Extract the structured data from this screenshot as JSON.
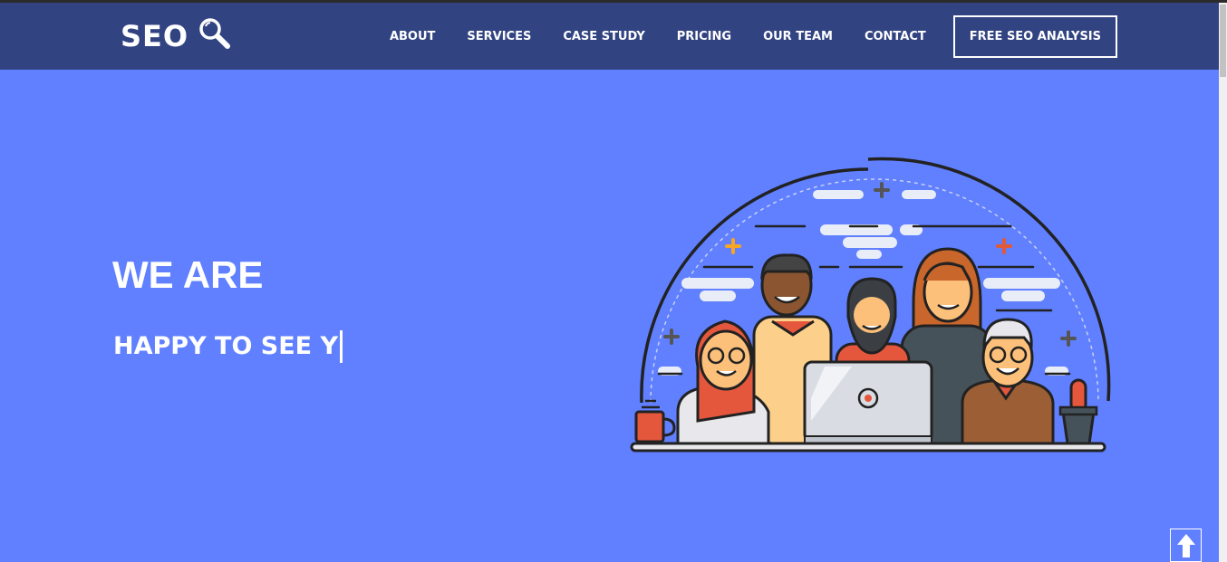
{
  "logo": {
    "text": "SEO",
    "icon": "magnifier-icon"
  },
  "nav": {
    "items": [
      {
        "label": "ABOUT"
      },
      {
        "label": "SERVICES"
      },
      {
        "label": "CASE STUDY"
      },
      {
        "label": "PRICING"
      },
      {
        "label": "OUR TEAM"
      },
      {
        "label": "CONTACT"
      }
    ],
    "cta_label": "FREE SEO ANALYSIS"
  },
  "hero": {
    "title": "WE ARE",
    "typed_text": "HAPPY TO SEE Y"
  },
  "illustration": {
    "subject": "team-illustration"
  },
  "back_to_top": {
    "icon": "arrow-up-icon"
  },
  "colors": {
    "navbar": "#324382",
    "hero_bg": "#6080ff",
    "text": "#ffffff"
  }
}
